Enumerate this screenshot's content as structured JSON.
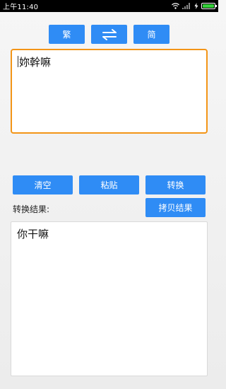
{
  "status_bar": {
    "time": "上午11:40"
  },
  "top_buttons": {
    "traditional_label": "繁",
    "swap_icon": "swap-arrows-icon",
    "simplified_label": "简"
  },
  "input": {
    "value": "妳幹嘛"
  },
  "actions": {
    "clear_label": "清空",
    "paste_label": "粘贴",
    "convert_label": "转换",
    "copy_result_label": "拷贝结果"
  },
  "result": {
    "label": "转换结果:",
    "value": "你干嘛"
  },
  "colors": {
    "button_blue": "#2f8cf5",
    "input_focus_border": "#f39517",
    "battery_green": "#35d03a"
  }
}
